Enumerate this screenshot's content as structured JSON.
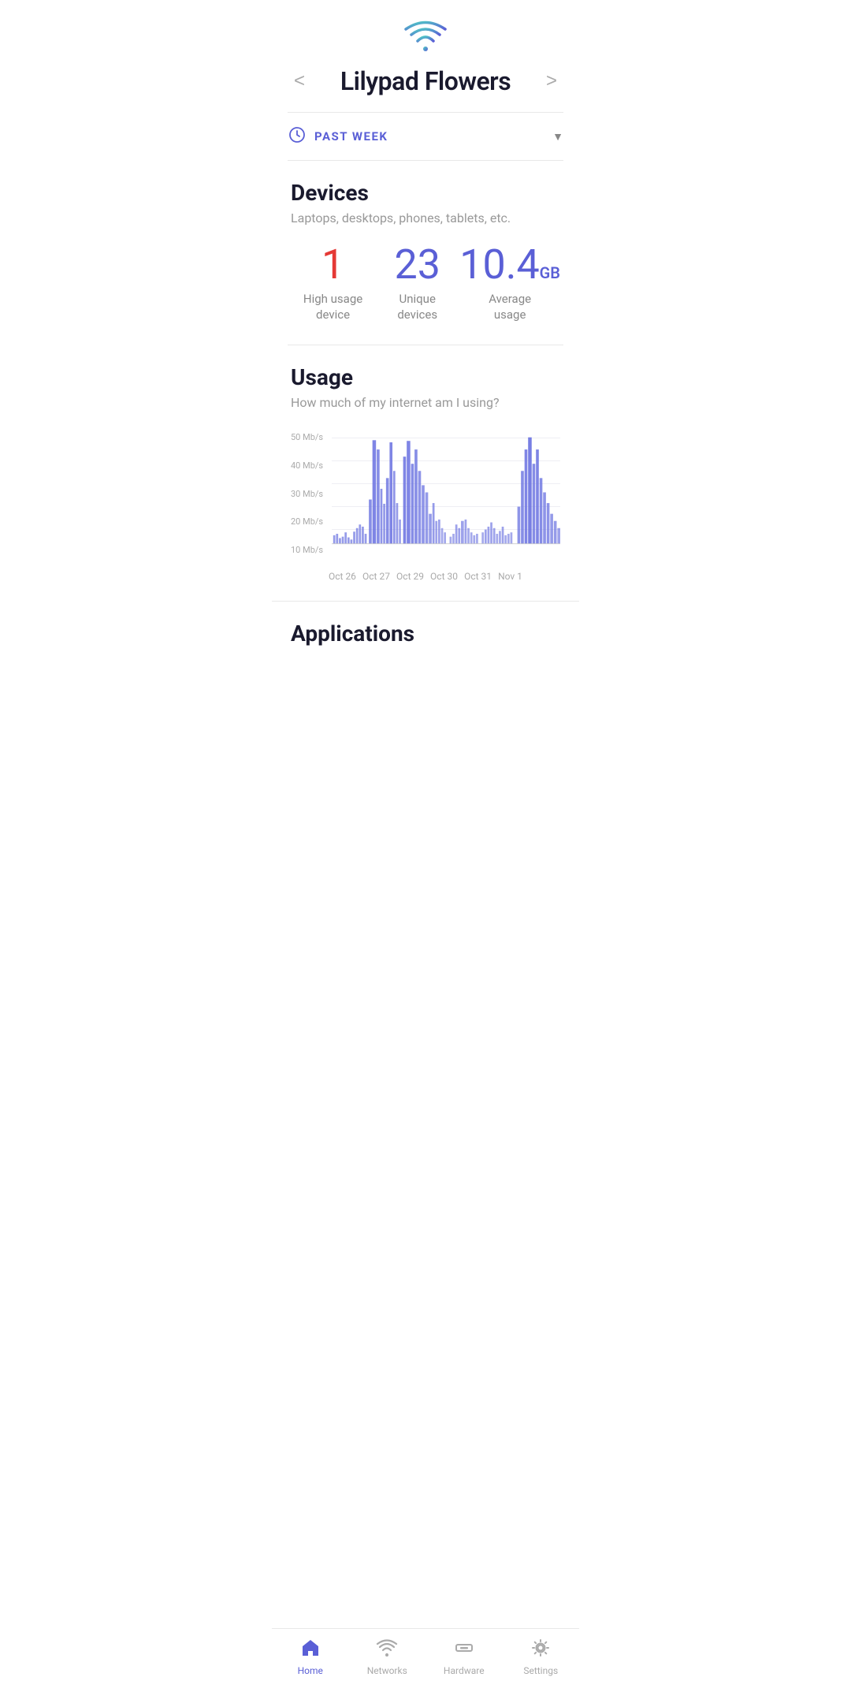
{
  "header": {
    "title": "Lilypad Flowers",
    "prev_label": "<",
    "next_label": ">"
  },
  "time_filter": {
    "label": "PAST WEEK"
  },
  "devices_section": {
    "title": "Devices",
    "subtitle": "Laptops, desktops, phones, tablets, etc.",
    "stats": [
      {
        "value": "1",
        "label": "High usage\ndevice",
        "color": "red"
      },
      {
        "value": "23",
        "label": "Unique\ndevices",
        "color": "purple"
      },
      {
        "value": "10.4",
        "gb": "GB",
        "label": "Average\nusage",
        "color": "purple"
      }
    ]
  },
  "usage_section": {
    "title": "Usage",
    "subtitle": "How much of my internet am I using?",
    "y_labels": [
      "50 Mb/s",
      "40 Mb/s",
      "30 Mb/s",
      "20 Mb/s",
      "10 Mb/s"
    ],
    "x_labels": [
      "Oct 26",
      "Oct 27",
      "Oct 29",
      "Oct 30",
      "Oct 31",
      "Nov 1"
    ]
  },
  "applications_section": {
    "title": "Applications"
  },
  "nav": {
    "items": [
      {
        "id": "home",
        "label": "Home",
        "active": true
      },
      {
        "id": "networks",
        "label": "Networks",
        "active": false
      },
      {
        "id": "hardware",
        "label": "Hardware",
        "active": false
      },
      {
        "id": "settings",
        "label": "Settings",
        "active": false
      }
    ]
  }
}
